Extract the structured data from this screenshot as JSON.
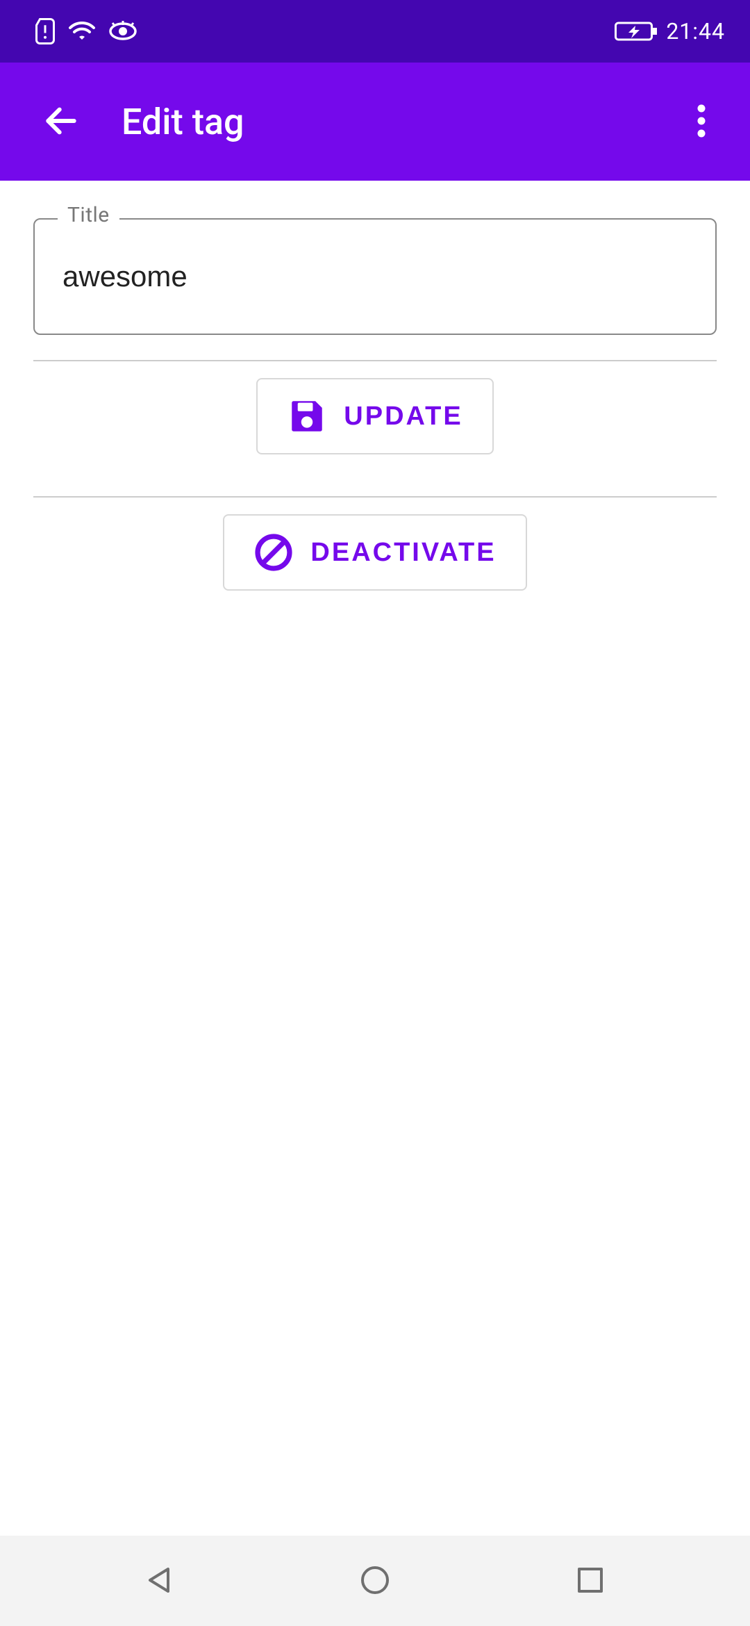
{
  "status_bar": {
    "time": "21:44"
  },
  "app_bar": {
    "title": "Edit tag"
  },
  "form": {
    "title_label": "Title",
    "title_value": "awesome"
  },
  "buttons": {
    "update_label": "UPDATE",
    "deactivate_label": "DEACTIVATE"
  },
  "colors": {
    "status_bar_bg": "#4406b0",
    "app_bar_bg": "#7509eb",
    "accent": "#7509eb"
  }
}
